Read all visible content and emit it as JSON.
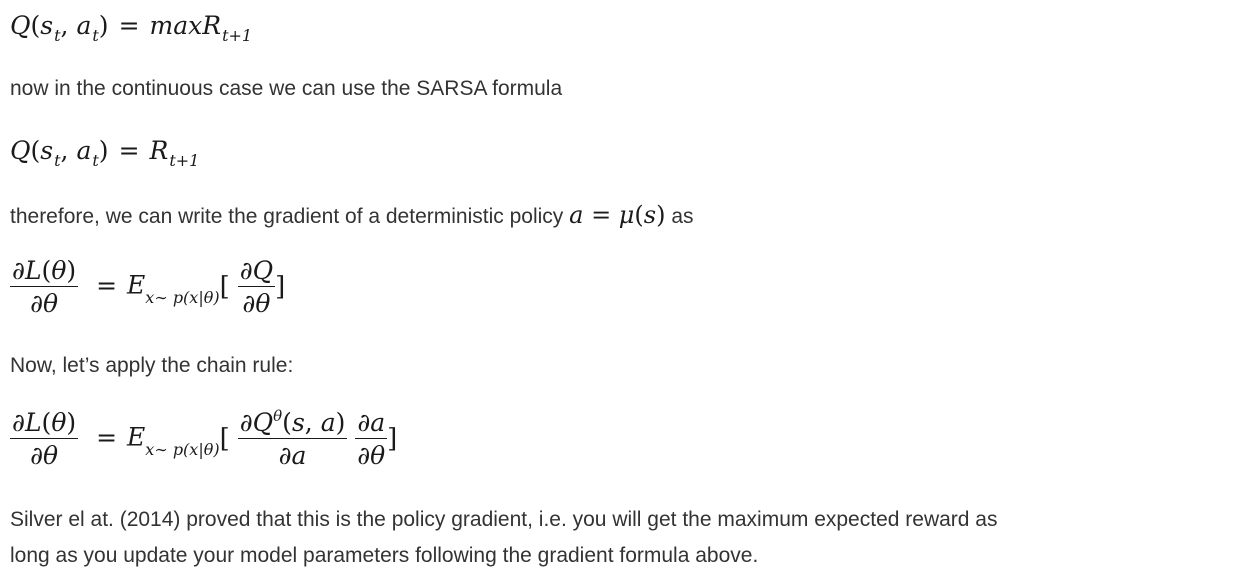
{
  "eq1": "Q(s_t, a_t) = max R_{t+1}",
  "text1": "now in the continuous case we can use the SARSA formula",
  "eq2": "Q(s_t, a_t) = R_{t+1}",
  "text2": "therefore, we can write the gradient of a deterministic policy",
  "text2_suffix": "as",
  "eq3": "∂L(θ)/∂θ = E_{x∼ p(x|θ)}[∂Q/∂θ]",
  "text3": "Now, let’s apply the chain rule:",
  "eq4": "∂L(θ)/∂θ = E_{x∼ p(x|θ)}[∂Q^θ(s,a)/∂a · ∂a/∂θ]",
  "text4_line1": "Silver el at. (2014) proved that this is the policy gradient, i.e. you will get the maximum expected reward as",
  "text4_line2": "long as you update your model parameters following the gradient formula above."
}
